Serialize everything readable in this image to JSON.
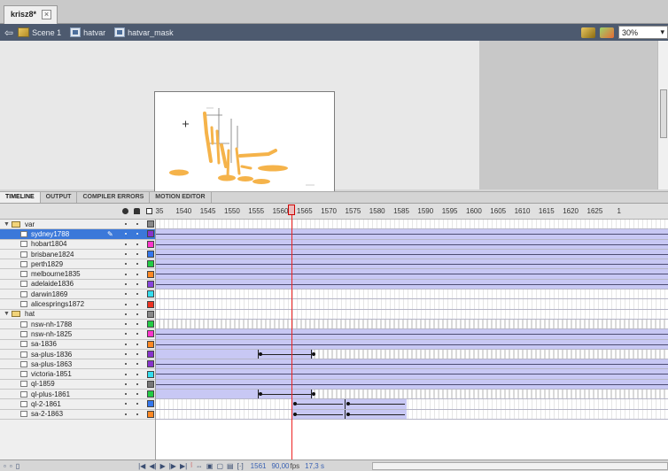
{
  "document_tab": {
    "title": "krisz8*",
    "close": "×"
  },
  "edit_bar": {
    "breadcrumb": [
      {
        "label": "Scene 1",
        "icon": "scene-icon"
      },
      {
        "label": "hatvar",
        "icon": "symbol-icon"
      },
      {
        "label": "hatvar_mask",
        "icon": "symbol-icon"
      }
    ],
    "zoom": "30%"
  },
  "timeline": {
    "tabs": [
      "TIMELINE",
      "OUTPUT",
      "COMPILER ERRORS",
      "MOTION EDITOR"
    ],
    "ruler": [
      "35",
      "1540",
      "1545",
      "1550",
      "1555",
      "1560",
      "1565",
      "1570",
      "1575",
      "1580",
      "1585",
      "1590",
      "1595",
      "1600",
      "1605",
      "1610",
      "1615",
      "1620",
      "1625",
      "1"
    ],
    "layers": [
      {
        "name": "var",
        "type": "folder",
        "color": "#888888"
      },
      {
        "name": "sydney1788",
        "type": "layer",
        "color": "#8833cc",
        "selected": true
      },
      {
        "name": "hobart1804",
        "type": "layer",
        "color": "#ff33cc"
      },
      {
        "name": "brisbane1824",
        "type": "layer",
        "color": "#3377ee"
      },
      {
        "name": "perth1829",
        "type": "layer",
        "color": "#22cc44"
      },
      {
        "name": "melbourne1835",
        "type": "layer",
        "color": "#ff8822"
      },
      {
        "name": "adelaide1836",
        "type": "layer",
        "color": "#8844dd"
      },
      {
        "name": "darwin1869",
        "type": "layer",
        "color": "#33ddee"
      },
      {
        "name": "alicesprings1872",
        "type": "layer",
        "color": "#ee3322"
      },
      {
        "name": "hat",
        "type": "folder",
        "color": "#888888"
      },
      {
        "name": "nsw-nh-1788",
        "type": "layer",
        "color": "#22cc44"
      },
      {
        "name": "nsw-nh-1825",
        "type": "layer",
        "color": "#ff33cc"
      },
      {
        "name": "sa-1836",
        "type": "layer",
        "color": "#ff8822"
      },
      {
        "name": "sa-plus-1836",
        "type": "layer",
        "color": "#8833cc"
      },
      {
        "name": "sa-plus-1863",
        "type": "layer",
        "color": "#8833cc"
      },
      {
        "name": "victoria-1851",
        "type": "layer",
        "color": "#33ddee"
      },
      {
        "name": "ql-1859",
        "type": "layer",
        "color": "#777777"
      },
      {
        "name": "ql-plus-1861",
        "type": "layer",
        "color": "#22cc44"
      },
      {
        "name": "ql-2-1861",
        "type": "layer",
        "color": "#3377ee"
      },
      {
        "name": "sa-2-1863",
        "type": "layer",
        "color": "#ff8822"
      }
    ]
  },
  "status": {
    "frame": "1561",
    "fps": "90,00",
    "fps_unit": "fps",
    "time": "17,3 s"
  }
}
